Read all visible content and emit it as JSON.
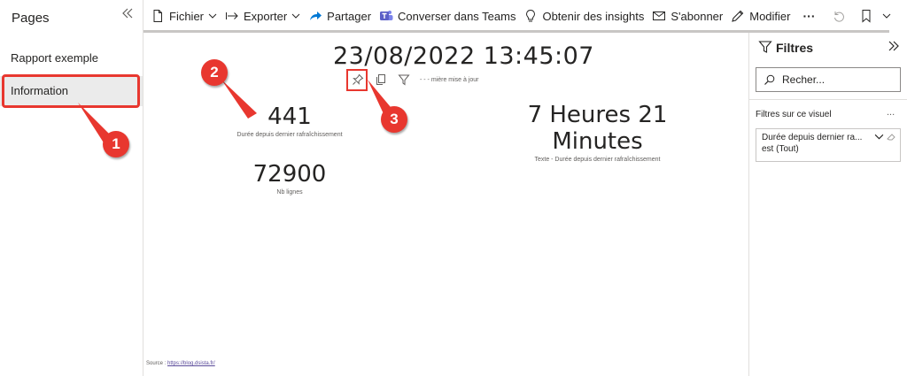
{
  "pages": {
    "title": "Pages",
    "items": [
      {
        "label": "Rapport exemple"
      },
      {
        "label": "Information"
      }
    ]
  },
  "toolbar": {
    "file": "Fichier",
    "export": "Exporter",
    "share": "Partager",
    "teams": "Converser dans Teams",
    "insights": "Obtenir des insights",
    "subscribe": "S'abonner",
    "edit": "Modifier",
    "more": "···"
  },
  "report": {
    "refresh_timestamp": "23/08/2022 13:45:07",
    "visual_header_text": "- - - mière mise à jour",
    "kpis": [
      {
        "value": "441",
        "label": "Durée depuis dernier rafraîchissement"
      },
      {
        "value": "7 Heures 21 Minutes",
        "label": "Texte - Durée depuis dernier rafraîchissement"
      },
      {
        "value": "72900",
        "label": "Nb lignes"
      }
    ],
    "source_label": "Source : ",
    "source_link": "https://blog.dsista.fr/"
  },
  "callouts": [
    "1",
    "2",
    "3"
  ],
  "filters": {
    "title": "Filtres",
    "search_placeholder": "Recher...",
    "section_label": "Filtres sur ce visuel",
    "section_more": "...",
    "card": {
      "name": "Durée depuis dernier ra...",
      "value": "est (Tout)"
    }
  },
  "colors": {
    "accent_red": "#e8372f",
    "teams_purple": "#5b5fc7",
    "share_blue": "#0078d4",
    "selected_page_bg": "#ebebeb"
  }
}
